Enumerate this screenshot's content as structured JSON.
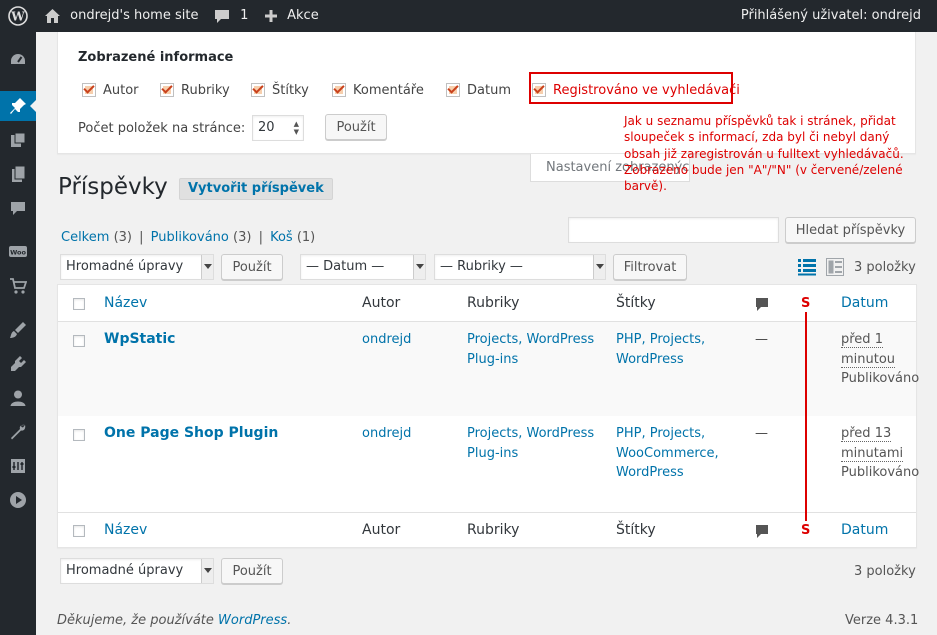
{
  "admin_bar": {
    "site_name": "ondrejd's home site",
    "comments_count": "1",
    "new_label": "Akce",
    "howdy": "Přihlášený uživatel: ondrejd"
  },
  "side_menu": {
    "items": [
      "dashboard-icon",
      "pin-icon",
      "media-icon",
      "pages-icon",
      "comments-icon",
      "woocommerce-icon",
      "cart-icon",
      "appearance-icon",
      "plugins-icon",
      "users-icon",
      "tools-icon",
      "settings-icon",
      "play-icon"
    ],
    "current": "pin-icon"
  },
  "screen_options": {
    "heading": "Zobrazené informace",
    "columns": [
      {
        "label": "Autor",
        "checked": true
      },
      {
        "label": "Rubriky",
        "checked": true
      },
      {
        "label": "Štítky",
        "checked": true
      },
      {
        "label": "Komentáře",
        "checked": true
      },
      {
        "label": "Datum",
        "checked": true
      },
      {
        "label": "Registrováno ve vyhledávači",
        "checked": true
      }
    ],
    "per_page_label": "Počet položek na stránce:",
    "per_page_value": "20",
    "apply_label": "Použít",
    "tab_label": "Nastavení zobrazených informací"
  },
  "annotation": {
    "text": "Jak u seznamu příspěvků tak i stránek, přidat sloupeček s informací, zda byl či nebyl daný obsah již zaregistrován u fulltext vyhledávačů. Zobrazeno bude jen \"A\"/\"N\" (v červené/zelené barvě).",
    "color": "#dd0000"
  },
  "page": {
    "title": "Příspěvky",
    "add_new": "Vytvořit příspěvek"
  },
  "views": {
    "all_label": "Celkem",
    "all_count": "(3)",
    "published_label": "Publikováno",
    "published_count": "(3)",
    "trash_label": "Koš",
    "trash_count": "(1)",
    "separator": "|"
  },
  "search": {
    "value": "",
    "button_label": "Hledat příspěvky"
  },
  "tablenav_top": {
    "bulk_actions": "Hromadné úpravy",
    "apply_label": "Použít",
    "date_filter": "— Datum —",
    "category_filter": "— Rubriky —",
    "filter_label": "Filtrovat",
    "items_count": "3 položky"
  },
  "table": {
    "headers": {
      "title": "Název",
      "author": "Autor",
      "categories": "Rubriky",
      "tags": "Štítky",
      "registered": "S",
      "date": "Datum"
    },
    "rows": [
      {
        "title": "WpStatic",
        "author": "ondrejd",
        "categories": "Projects, WordPress Plug-ins",
        "tags": "PHP, Projects, WordPress",
        "comments": "—",
        "date_rel": "před 1 minutou",
        "status": "Publikováno"
      },
      {
        "title": "One Page Shop Plugin",
        "author": "ondrejd",
        "categories": "Projects, WordPress Plug-ins",
        "tags": "PHP, Projects, WooCommerce, WordPress",
        "comments": "—",
        "date_rel": "před 13 minutami",
        "status": "Publikováno"
      }
    ]
  },
  "tablenav_bottom": {
    "bulk_actions": "Hromadné úpravy",
    "apply_label": "Použít",
    "items_count": "3 položky"
  },
  "footer": {
    "thanks_prefix": "Děkujeme, že používáte ",
    "thanks_link": "WordPress",
    "thanks_suffix": ".",
    "version": "Verze 4.3.1"
  },
  "colors": {
    "admin_bar": "#23282d",
    "link": "#0073aa",
    "highlight": "#dd0000"
  }
}
